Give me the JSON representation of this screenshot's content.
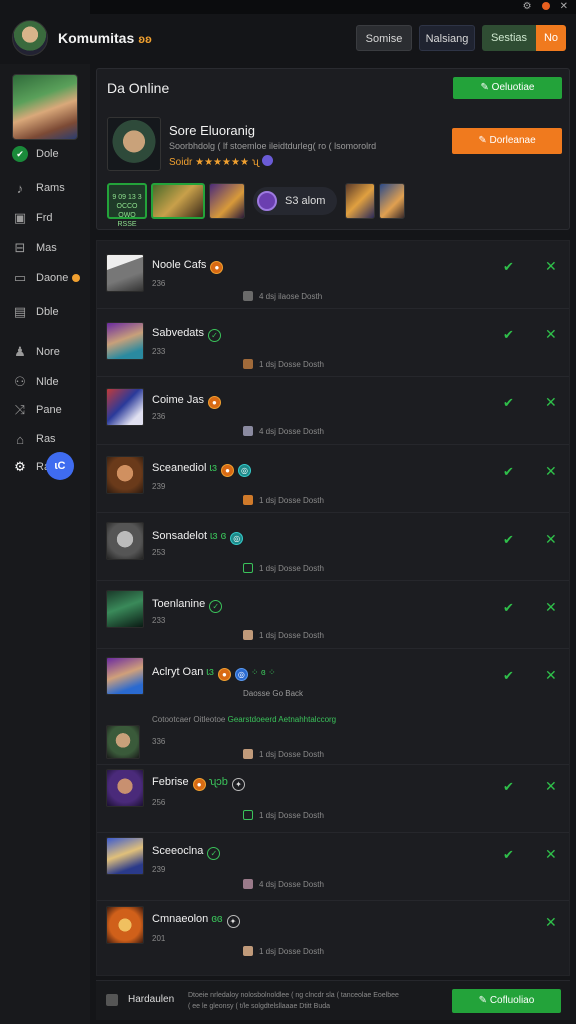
{
  "window": {
    "controls": [
      "⚙",
      "✕"
    ]
  },
  "header": {
    "title": "Komumitas",
    "title_badge": "ʚʚ",
    "buttons": [
      "Somise",
      "Nalsiang",
      "Sestias",
      "No"
    ]
  },
  "sidebar": {
    "items": [
      {
        "label": "Dole",
        "icon": "check-circle-icon"
      },
      {
        "label": "Rams",
        "icon": "music-note-icon"
      },
      {
        "label": "Frd",
        "icon": "square-icon"
      },
      {
        "label": "Mas",
        "icon": "inbox-icon"
      },
      {
        "label": "Daone",
        "icon": "chat-icon"
      },
      {
        "label": "Dble",
        "icon": "grid-icon"
      },
      {
        "label": "Nore",
        "icon": "person-icon"
      },
      {
        "label": "Nlde",
        "icon": "users-icon"
      },
      {
        "label": "Pane",
        "icon": "shuffle-icon"
      },
      {
        "label": "Ras",
        "icon": "home-icon"
      },
      {
        "label": "Ra",
        "icon": "gear-icon"
      }
    ],
    "fab_label": "ɩC"
  },
  "online": {
    "title": "Da Online",
    "top_button": "✎ Oeluotiae",
    "featured": {
      "name": "Sore Eluoranig",
      "description": "Soorbhdolg ( lf stoemloe ileidtdurleg( ro ( lsomorolrd",
      "stars": "Soidr ★★★★★★ ʯ",
      "button": "✎ Dorleanae"
    },
    "tile_text": "9 09 13 3\nOCCO OWO\nRSSE",
    "chip_label": "S3 alom"
  },
  "rows": [
    {
      "name": "Noole Cafs",
      "badges": [
        "o"
      ],
      "sub": "236",
      "meta": "4 dsj ilaose Dosth",
      "check": true
    },
    {
      "name": "Sabvedats",
      "badges": [
        "g"
      ],
      "sub": "233",
      "meta": "1 dsj Dosse Dosth",
      "check": true
    },
    {
      "name": "Coime Jas",
      "badges": [
        "o"
      ],
      "sub": "236",
      "meta": "4 dsj Dosse Dosth",
      "check": true
    },
    {
      "name": "Sceanediol",
      "badges": [
        "gtxt",
        "o",
        "c"
      ],
      "green_text": "ɩɜ",
      "sub": "239",
      "meta": "1 dsj Dosse Dosth",
      "check": true
    },
    {
      "name": "Sonsadelot",
      "badges": [
        "gtxt",
        "c"
      ],
      "green_text": "ɩɜ ɞ",
      "sub": "253",
      "meta": "1 dsj Dosse Dosth",
      "check": true
    },
    {
      "name": "Toenlanine",
      "badges": [
        "g"
      ],
      "sub": "233",
      "meta": "1 dsj Dosse Dosth",
      "check": true
    },
    {
      "name": "Aclryt Oan",
      "badges": [
        "gtxt",
        "o",
        "bl"
      ],
      "green_text": "ɩɜ",
      "trail": "⁘ ɞ ⁘",
      "sub": "",
      "extra": "Daosse Go Back",
      "note_a": "Cotootcaer Oitleotoe",
      "note_b": "Gearstdoeerd Aetnahhtalccorg",
      "sub2": "336",
      "meta": "1 dsj Dosse Dosth",
      "check": true
    },
    {
      "name": "Febrise",
      "badges": [
        "o",
        "gtxt",
        "w"
      ],
      "green_text": "ʯɔb",
      "sub": "256",
      "meta": "1 dsj Dosse Dosth",
      "check": true
    },
    {
      "name": "Sceeoclna",
      "badges": [
        "g"
      ],
      "sub": "239",
      "meta": "4 dsj Dosse Dosth",
      "check": true
    },
    {
      "name": "Cmnaeolon",
      "badges": [
        "gtxt",
        "w"
      ],
      "green_text": "ɞɞ",
      "sub": "201",
      "meta": "1 dsj Dosse Dosth",
      "check": false
    }
  ],
  "footer": {
    "label": "Hardaulen",
    "text": "Dtoeie nrledaloy nolosbolnoldlee ( ng clncdr sla ( tanceolae Eoelbee ( ee le gleonsy ( t/le solgdtelsllaaae Dtitt Buda",
    "button": "✎ Cofluoliao"
  },
  "colors": {
    "accent_green": "#23a33a",
    "accent_orange": "#f07a1e",
    "background": "#141518"
  }
}
